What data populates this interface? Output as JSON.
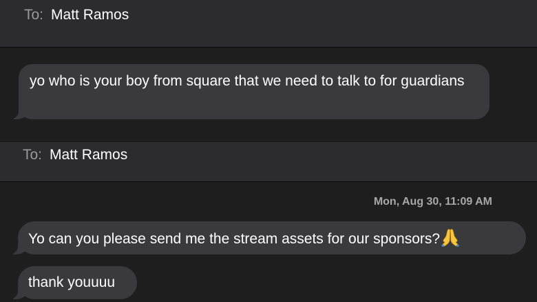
{
  "conversation_1": {
    "header": {
      "to_label": "To:",
      "recipient": "Matt Ramos"
    },
    "messages": [
      {
        "text": "yo who is your boy from square that we need to talk to for guardians"
      }
    ]
  },
  "conversation_2": {
    "header": {
      "to_label": "To:",
      "recipient": "Matt Ramos"
    },
    "timestamp": "Mon, Aug 30, 11:09 AM",
    "messages": [
      {
        "text": "Yo can you please send me the stream assets for our sponsors?",
        "emoji": "folded-hands-icon"
      },
      {
        "text": "thank youuuu"
      }
    ]
  },
  "colors": {
    "background": "#1e1e1e",
    "header_background": "#2c2c2e",
    "bubble_incoming": "#3a3a3c",
    "secondary_text": "#9a9a9a"
  }
}
